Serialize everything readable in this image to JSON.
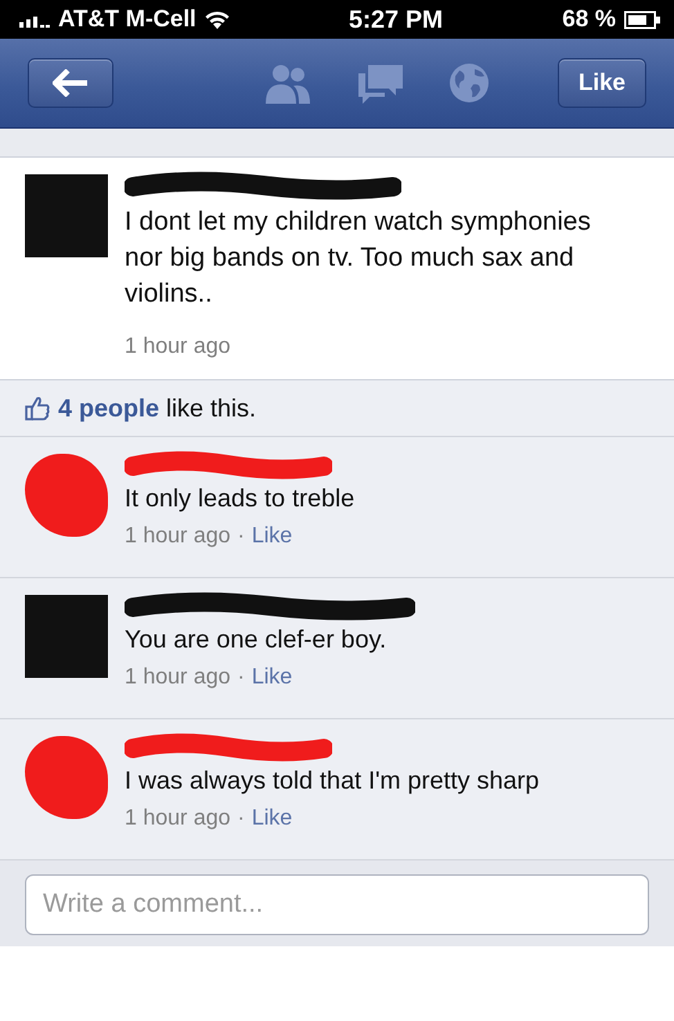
{
  "status_bar": {
    "carrier": "AT&T M-Cell",
    "time": "5:27 PM",
    "battery": "68 %"
  },
  "nav_bar": {
    "like_button": "Like"
  },
  "post": {
    "color": "#111111",
    "text": "I dont let my children watch symphonies nor big bands on tv. Too much sax and violins..",
    "time": "1 hour ago"
  },
  "likes": {
    "count": "4 people",
    "text": "like this."
  },
  "comments": [
    {
      "color": "#f01c1c",
      "text": "It only leads to treble",
      "time": "1 hour ago",
      "separator": "·",
      "like": "Like"
    },
    {
      "color": "#111111",
      "text": "You are one clef-er boy.",
      "time": "1 hour ago",
      "separator": "·",
      "like": "Like"
    },
    {
      "color": "#f01c1c",
      "text": "I was always told that I'm pretty sharp",
      "time": "1 hour ago",
      "separator": "·",
      "like": "Like"
    }
  ],
  "comment_box": {
    "placeholder": "Write a comment..."
  }
}
